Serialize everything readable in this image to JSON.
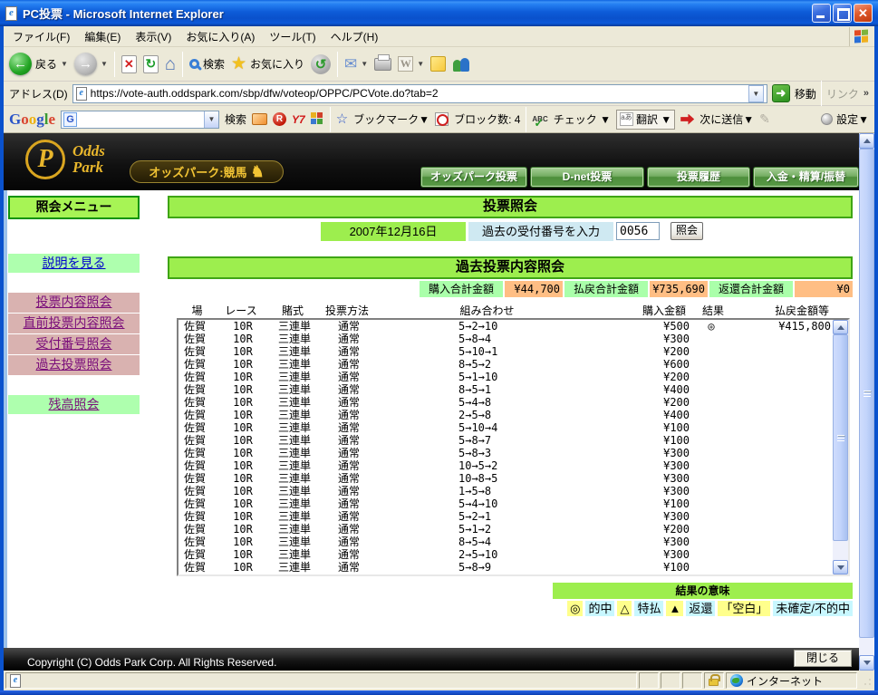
{
  "icons": {
    "ie_e": "e",
    "g_badge": "G",
    "r_badge": "R",
    "y_badge": "Y7",
    "abc": "ABC",
    "word": "W",
    "back_arrow": "←",
    "fwd_arrow": "→",
    "stop_x": "✕",
    "refresh": "↻",
    "home": "⌂",
    "star": "★",
    "history": "↺",
    "mail": "✉",
    "pencil": "✎",
    "horse": "♞",
    "dropdown": "▼",
    "chevrons": "»",
    "go_arrow": "➜",
    "logo_p": "P",
    "ai": "aあ"
  },
  "window": {
    "title": "PC投票 - Microsoft Internet Explorer",
    "menu": [
      "ファイル(F)",
      "編集(E)",
      "表示(V)",
      "お気に入り(A)",
      "ツール(T)",
      "ヘルプ(H)"
    ],
    "toolbar": {
      "back": "戻る",
      "search": "検索",
      "favorites": "お気に入り"
    },
    "address": {
      "label": "アドレス(D)",
      "url": "https://vote-auth.oddspark.com/sbp/dfw/voteop/OPPC/PCVote.do?tab=2",
      "go": "移動",
      "links": "リンク"
    },
    "status": {
      "zone": "インターネット"
    }
  },
  "googlebar": {
    "logo_letters": [
      "G",
      "o",
      "o",
      "g",
      "l",
      "e"
    ],
    "search": "検索",
    "bookmarks": "ブックマーク▼",
    "blocked": "ブロック数: 4",
    "check": "チェック ▼",
    "translate": "翻訳 ▼",
    "send": "次に送信▼",
    "settings": "設定▼"
  },
  "site_header": {
    "logo_top": "Odds",
    "logo_bottom": "Park",
    "badge": "オッズパーク:競馬",
    "nav": [
      "オッズパーク投票",
      "D-net投票",
      "投票履歴",
      "入金・精算/振替"
    ]
  },
  "sidebar": {
    "title": "照会メニュー",
    "help": "説明を見る",
    "links": [
      "投票内容照会",
      "直前投票内容照会",
      "受付番号照会",
      "過去投票照会"
    ],
    "balance": "残高照会"
  },
  "main": {
    "section1": "投票照会",
    "date": "2007年12月16日",
    "receipt_label": "過去の受付番号を入力",
    "receipt_value": "0056",
    "inquiry": "照会",
    "section2": "過去投票内容照会",
    "summary": [
      {
        "label": "購入合計金額",
        "value": "¥44,700"
      },
      {
        "label": "払戻合計金額",
        "value": "¥735,690"
      },
      {
        "label": "返還合計金額",
        "value": "¥0"
      }
    ],
    "table": {
      "headers": [
        "場",
        "レース",
        "賭式",
        "投票方法",
        "組み合わせ",
        "購入金額",
        "結果",
        "払戻金額等"
      ],
      "rows": [
        {
          "venue": "佐賀",
          "race": "10R",
          "bet_type": "三連単",
          "method": "通常",
          "combination": "5→2→10",
          "amount": "¥500",
          "result": "◎",
          "payout": "¥415,800"
        },
        {
          "venue": "佐賀",
          "race": "10R",
          "bet_type": "三連単",
          "method": "通常",
          "combination": "5→8→4",
          "amount": "¥300",
          "result": "",
          "payout": ""
        },
        {
          "venue": "佐賀",
          "race": "10R",
          "bet_type": "三連単",
          "method": "通常",
          "combination": "5→10→1",
          "amount": "¥200",
          "result": "",
          "payout": ""
        },
        {
          "venue": "佐賀",
          "race": "10R",
          "bet_type": "三連単",
          "method": "通常",
          "combination": "8→5→2",
          "amount": "¥600",
          "result": "",
          "payout": ""
        },
        {
          "venue": "佐賀",
          "race": "10R",
          "bet_type": "三連単",
          "method": "通常",
          "combination": "5→1→10",
          "amount": "¥200",
          "result": "",
          "payout": ""
        },
        {
          "venue": "佐賀",
          "race": "10R",
          "bet_type": "三連単",
          "method": "通常",
          "combination": "8→5→1",
          "amount": "¥400",
          "result": "",
          "payout": ""
        },
        {
          "venue": "佐賀",
          "race": "10R",
          "bet_type": "三連単",
          "method": "通常",
          "combination": "5→4→8",
          "amount": "¥200",
          "result": "",
          "payout": ""
        },
        {
          "venue": "佐賀",
          "race": "10R",
          "bet_type": "三連単",
          "method": "通常",
          "combination": "2→5→8",
          "amount": "¥400",
          "result": "",
          "payout": ""
        },
        {
          "venue": "佐賀",
          "race": "10R",
          "bet_type": "三連単",
          "method": "通常",
          "combination": "5→10→4",
          "amount": "¥100",
          "result": "",
          "payout": ""
        },
        {
          "venue": "佐賀",
          "race": "10R",
          "bet_type": "三連単",
          "method": "通常",
          "combination": "5→8→7",
          "amount": "¥100",
          "result": "",
          "payout": ""
        },
        {
          "venue": "佐賀",
          "race": "10R",
          "bet_type": "三連単",
          "method": "通常",
          "combination": "5→8→3",
          "amount": "¥300",
          "result": "",
          "payout": ""
        },
        {
          "venue": "佐賀",
          "race": "10R",
          "bet_type": "三連単",
          "method": "通常",
          "combination": "10→5→2",
          "amount": "¥300",
          "result": "",
          "payout": ""
        },
        {
          "venue": "佐賀",
          "race": "10R",
          "bet_type": "三連単",
          "method": "通常",
          "combination": "10→8→5",
          "amount": "¥300",
          "result": "",
          "payout": ""
        },
        {
          "venue": "佐賀",
          "race": "10R",
          "bet_type": "三連単",
          "method": "通常",
          "combination": "1→5→8",
          "amount": "¥300",
          "result": "",
          "payout": ""
        },
        {
          "venue": "佐賀",
          "race": "10R",
          "bet_type": "三連単",
          "method": "通常",
          "combination": "5→4→10",
          "amount": "¥100",
          "result": "",
          "payout": ""
        },
        {
          "venue": "佐賀",
          "race": "10R",
          "bet_type": "三連単",
          "method": "通常",
          "combination": "5→2→1",
          "amount": "¥300",
          "result": "",
          "payout": ""
        },
        {
          "venue": "佐賀",
          "race": "10R",
          "bet_type": "三連単",
          "method": "通常",
          "combination": "5→1→2",
          "amount": "¥200",
          "result": "",
          "payout": ""
        },
        {
          "venue": "佐賀",
          "race": "10R",
          "bet_type": "三連単",
          "method": "通常",
          "combination": "8→5→4",
          "amount": "¥300",
          "result": "",
          "payout": ""
        },
        {
          "venue": "佐賀",
          "race": "10R",
          "bet_type": "三連単",
          "method": "通常",
          "combination": "2→5→10",
          "amount": "¥300",
          "result": "",
          "payout": ""
        },
        {
          "venue": "佐賀",
          "race": "10R",
          "bet_type": "三連単",
          "method": "通常",
          "combination": "5→8→9",
          "amount": "¥100",
          "result": "",
          "payout": ""
        }
      ]
    },
    "legend_title": "結果の意味",
    "legend": [
      {
        "symbol": "◎",
        "label": "的中"
      },
      {
        "symbol": "△",
        "label": "特払"
      },
      {
        "symbol": "▲",
        "label": "返還"
      },
      {
        "symbol": "「空白」",
        "label": "未確定/不的中"
      }
    ]
  },
  "footer": {
    "copyright": "Copyright (C) Odds Park Corp. All Rights Reserved.",
    "close": "閉じる"
  }
}
